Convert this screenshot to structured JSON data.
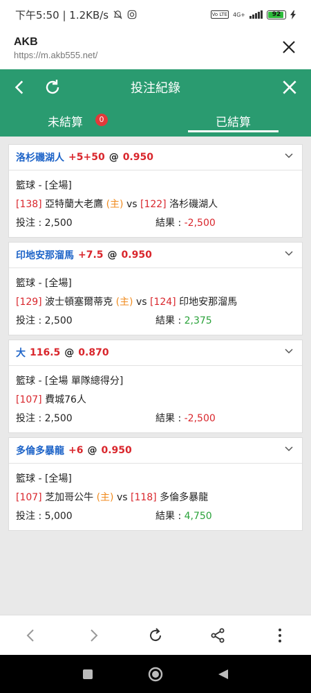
{
  "statusbar": {
    "time_speed": "下午5:50 | 1.2KB/s",
    "network": "4G+",
    "battery": "92"
  },
  "browser": {
    "site_title": "AKB",
    "url": "https://m.akb555.net/"
  },
  "app": {
    "title": "投注紀錄",
    "tabs": [
      {
        "label": "未結算",
        "badge": "0"
      },
      {
        "label": "已結算"
      }
    ]
  },
  "bets": [
    {
      "team": "洛杉磯湖人",
      "line": "+5+50",
      "at": "@",
      "odds": "0.950",
      "sport": "籃球 - [全場]",
      "home_id": "[138]",
      "home_team": "亞特蘭大老鷹",
      "home_tag": "(主)",
      "vs": "vs",
      "away_id": "[122]",
      "away_team": "洛杉磯湖人",
      "stake_label": "投注 : 2,500",
      "result_label": "結果 : ",
      "result_value": "-2,500"
    },
    {
      "team": "印地安那溜馬",
      "line": "+7.5",
      "at": "@",
      "odds": "0.950",
      "sport": "籃球 - [全場]",
      "home_id": "[129]",
      "home_team": "波士頓塞爾蒂克",
      "home_tag": "(主)",
      "vs": "vs",
      "away_id": "[124]",
      "away_team": "印地安那溜馬",
      "stake_label": "投注 : 2,500",
      "result_label": "結果 : ",
      "result_value": "2,375"
    },
    {
      "team": "大",
      "line": "116.5",
      "at": "@",
      "odds": "0.870",
      "sport": "籃球 - [全場 單隊總得分]",
      "home_id": "[107]",
      "home_team": "費城76人",
      "stake_label": "投注 : 2,500",
      "result_label": "結果 : ",
      "result_value": "-2,500"
    },
    {
      "team": "多倫多暴龍",
      "line": "+6",
      "at": "@",
      "odds": "0.950",
      "sport": "籃球 - [全場]",
      "home_id": "[107]",
      "home_team": "芝加哥公牛",
      "home_tag": "(主)",
      "vs": "vs",
      "away_id": "[118]",
      "away_team": "多倫多暴龍",
      "stake_label": "投注 : 5,000",
      "result_label": "結果 : ",
      "result_value": "4,750"
    }
  ],
  "colors": {
    "header_green": "#2a9b70",
    "accent_red": "#d9262c",
    "team_blue": "#1e64c8",
    "home_orange": "#f08a1d",
    "win_green": "#2aa23a"
  }
}
